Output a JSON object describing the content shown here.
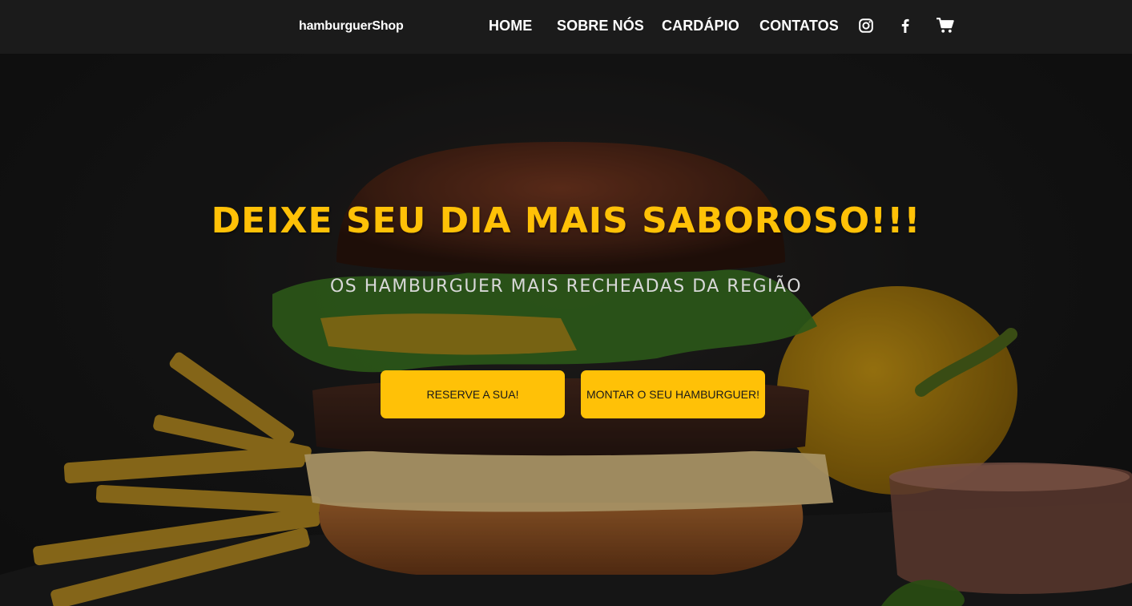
{
  "navbar": {
    "brand": "hamburguerShop",
    "links": [
      "HOME",
      "SOBRE NÓS",
      "CARDÁPIO",
      "CONTATOS"
    ],
    "icons": [
      "instagram-icon",
      "facebook-icon",
      "shopping-cart-icon"
    ]
  },
  "hero": {
    "title": "DEIXE SEU DIA MAIS SABOROSO!!!",
    "subtitle": "OS HAMBURGUER MAIS RECHEADAS DA REGIÃO",
    "buttons": {
      "reserve": "RESERVE A SUA!",
      "build": "MONTAR O SEU HAMBURGUER!"
    }
  },
  "colors": {
    "accent": "#ffc107",
    "navbar_bg": "#1b1b1b",
    "hero_bg": "#131313",
    "button_text": "#1a1a1a"
  }
}
